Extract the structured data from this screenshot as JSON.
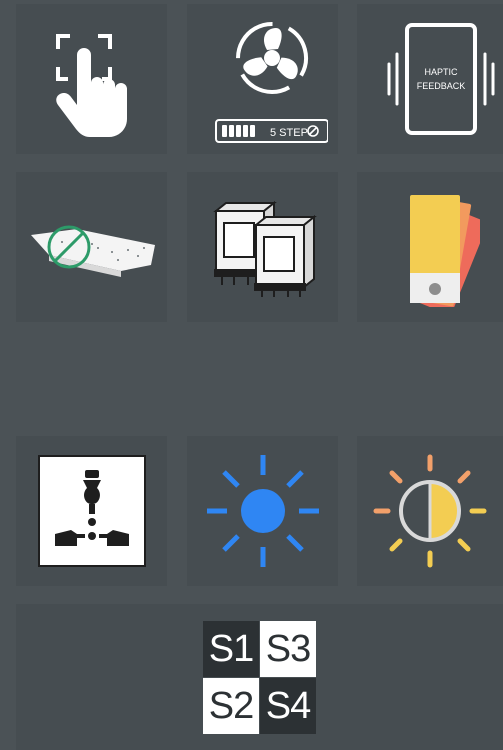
{
  "tiles": {
    "touch": {
      "icon": "finger-touch-icon"
    },
    "fan": {
      "icon": "fan-speed-icon",
      "step_label": "5 STEP",
      "colors": {
        "glyph": "#ffffff"
      }
    },
    "haptic": {
      "icon": "haptic-phone-icon",
      "line1": "HAPTIC",
      "line2": "FEEDBACK"
    },
    "sensor": {
      "icon": "no-sensor-board-icon",
      "colors": {
        "ring": "#2d9b69"
      }
    },
    "relay": {
      "icon": "relay-icon"
    },
    "color": {
      "icon": "color-swatch-icon",
      "colors": {
        "yellow": "#f3cd52",
        "orange": "#f29a5e",
        "red": "#ee6b5b"
      }
    },
    "socket": {
      "icon": "universal-socket-icon"
    },
    "dimmer": {
      "icon": "brightness-sun-icon",
      "colors": {
        "blue": "#2f86f3"
      }
    },
    "cct": {
      "icon": "color-temperature-sun-icon",
      "colors": {
        "warm": "#f2a06a",
        "yellow": "#f3cd52"
      }
    },
    "switches": {
      "icon": "switch-grid-icon",
      "items": [
        "S1",
        "S3",
        "S2",
        "S4"
      ]
    }
  }
}
